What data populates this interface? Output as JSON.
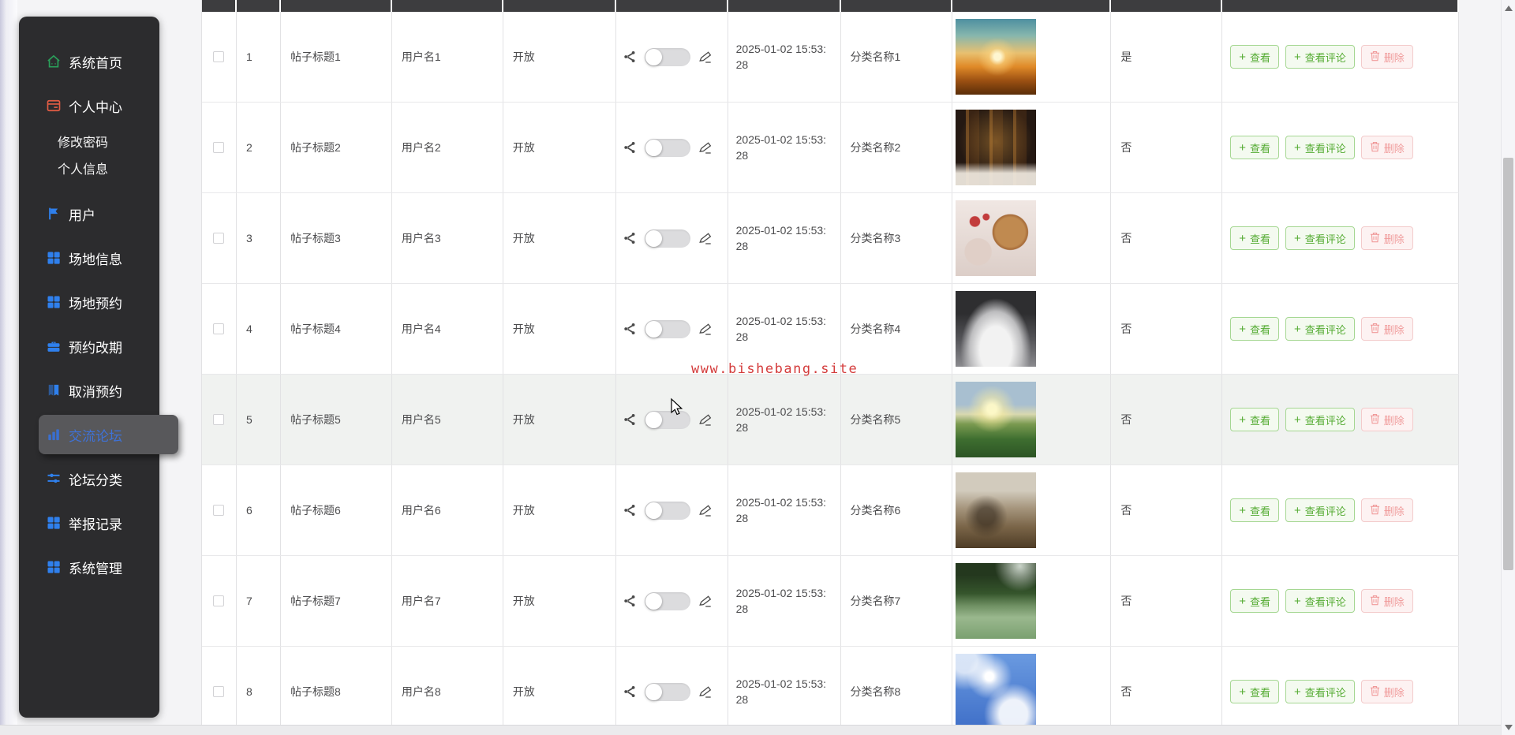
{
  "watermark": "www.bishebang.site",
  "icon_glyphs": {
    "plus": "+"
  },
  "sidebar": {
    "items": [
      {
        "label": "系统首页",
        "icon": "home",
        "type": "main"
      },
      {
        "label": "个人中心",
        "icon": "profile",
        "type": "main"
      },
      {
        "label": "修改密码",
        "type": "sub"
      },
      {
        "label": "个人信息",
        "type": "sub"
      },
      {
        "label": "用户",
        "icon": "flag",
        "type": "main"
      },
      {
        "label": "场地信息",
        "icon": "grid",
        "type": "main"
      },
      {
        "label": "场地预约",
        "icon": "grid",
        "type": "main"
      },
      {
        "label": "预约改期",
        "icon": "briefcase",
        "type": "main"
      },
      {
        "label": "取消预约",
        "icon": "book",
        "type": "main"
      },
      {
        "label": "交流论坛",
        "icon": "chart",
        "type": "main",
        "active": true
      },
      {
        "label": "论坛分类",
        "icon": "sliders",
        "type": "main"
      },
      {
        "label": "举报记录",
        "icon": "grid",
        "type": "main"
      },
      {
        "label": "系统管理",
        "icon": "grid",
        "type": "main"
      }
    ]
  },
  "table": {
    "action_labels": {
      "view": "查看",
      "comments": "查看评论",
      "delete": "删除"
    },
    "rows": [
      {
        "index": "1",
        "title": "帖子标题1",
        "username": "用户名1",
        "status": "开放",
        "switch_on": false,
        "time": "2025-01-02 15:53:28",
        "category": "分类名称1",
        "image": "runner-sunset",
        "is_top": "是",
        "hovered": false
      },
      {
        "index": "2",
        "title": "帖子标题2",
        "username": "用户名2",
        "status": "开放",
        "switch_on": false,
        "time": "2025-01-02 15:53:28",
        "category": "分类名称2",
        "image": "library-books",
        "is_top": "否",
        "hovered": false
      },
      {
        "index": "3",
        "title": "帖子标题3",
        "username": "用户名3",
        "status": "开放",
        "switch_on": false,
        "time": "2025-01-02 15:53:28",
        "category": "分类名称3",
        "image": "breakfast-food",
        "is_top": "否",
        "hovered": false
      },
      {
        "index": "4",
        "title": "帖子标题4",
        "username": "用户名4",
        "status": "开放",
        "switch_on": false,
        "time": "2025-01-02 15:53:28",
        "category": "分类名称4",
        "image": "open-book",
        "is_top": "否",
        "hovered": false
      },
      {
        "index": "5",
        "title": "帖子标题5",
        "username": "用户名5",
        "status": "开放",
        "switch_on": false,
        "time": "2025-01-02 15:53:28",
        "category": "分类名称5",
        "image": "field-sunrise",
        "is_top": "否",
        "hovered": true
      },
      {
        "index": "6",
        "title": "帖子标题6",
        "username": "用户名6",
        "status": "开放",
        "switch_on": false,
        "time": "2025-01-02 15:53:28",
        "category": "分类名称6",
        "image": "glasses-books",
        "is_top": "否",
        "hovered": false
      },
      {
        "index": "7",
        "title": "帖子标题7",
        "username": "用户名7",
        "status": "开放",
        "switch_on": false,
        "time": "2025-01-02 15:53:28",
        "category": "分类名称7",
        "image": "forest-river",
        "is_top": "否",
        "hovered": false
      },
      {
        "index": "8",
        "title": "帖子标题8",
        "username": "用户名8",
        "status": "开放",
        "switch_on": false,
        "time": "2025-01-02 15:53:28",
        "category": "分类名称8",
        "image": "blue-sky",
        "is_top": "否",
        "hovered": false
      }
    ]
  }
}
